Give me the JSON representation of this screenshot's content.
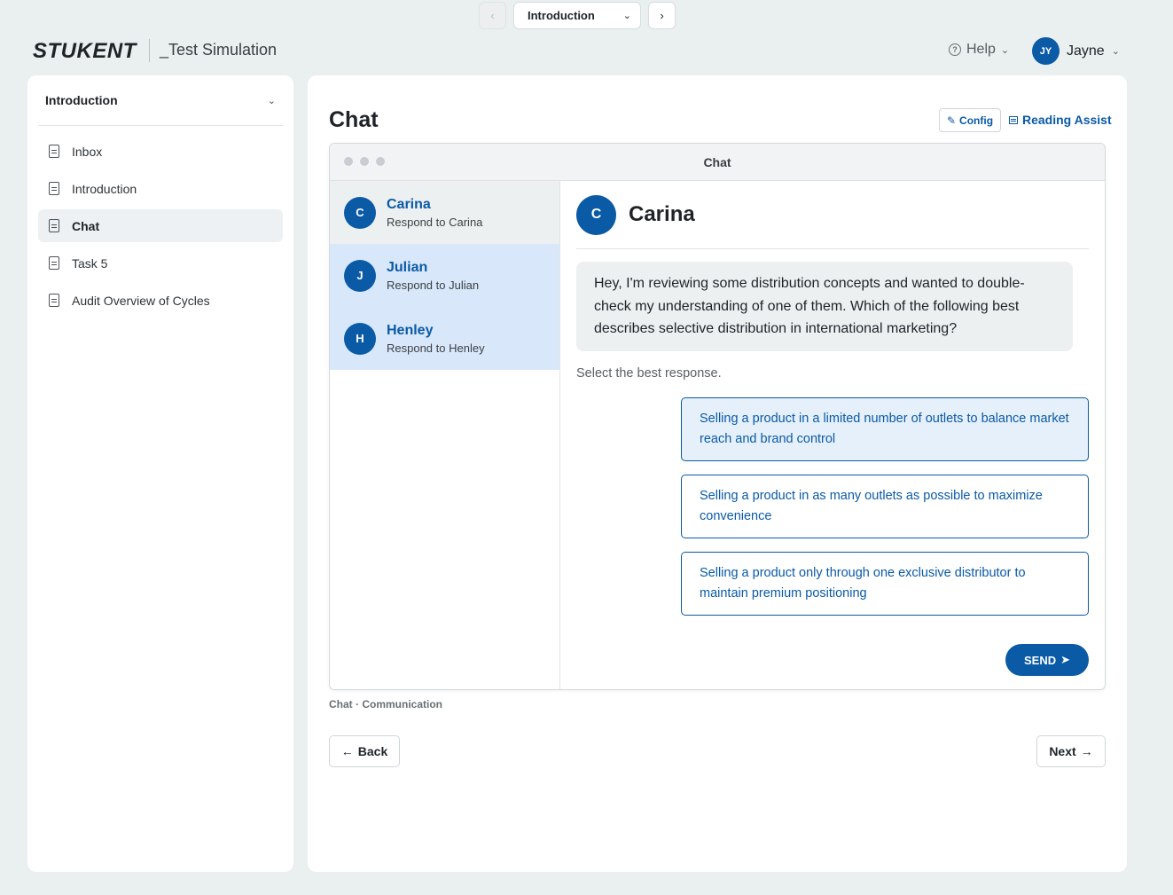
{
  "topnav": {
    "prev_symbol": "‹",
    "next_symbol": "›",
    "selected_module": "Introduction",
    "chevron": "⌄"
  },
  "header": {
    "logo": "STUKENT",
    "simulation_title": "_Test Simulation",
    "help_label": "Help",
    "help_chevron": "⌄",
    "user_initials": "JY",
    "user_name": "Jayne",
    "user_chevron": "⌄"
  },
  "sidebar": {
    "title": "Introduction",
    "chevron": "⌄",
    "items": [
      {
        "label": "Inbox"
      },
      {
        "label": "Introduction"
      },
      {
        "label": "Chat"
      },
      {
        "label": "Task 5"
      },
      {
        "label": "Audit Overview of Cycles"
      }
    ]
  },
  "main": {
    "title": "Chat",
    "config_label": "Config",
    "reading_assist_label": "Reading Assist",
    "window_title": "Chat",
    "contacts": [
      {
        "initial": "C",
        "name": "Carina",
        "subtitle": "Respond to Carina"
      },
      {
        "initial": "J",
        "name": "Julian",
        "subtitle": "Respond to Julian"
      },
      {
        "initial": "H",
        "name": "Henley",
        "subtitle": "Respond to Henley"
      }
    ],
    "conversation": {
      "initial": "C",
      "name": "Carina",
      "message": "Hey, I'm reviewing some distribution concepts and wanted to double-check my understanding of one of them. Which of the following best describes selective distribution in international marketing?",
      "hint": "Select the best response.",
      "options": [
        "Selling a product in a limited number of outlets to balance market reach and brand control",
        "Selling a product in as many outlets as possible to maximize convenience",
        "Selling a product only through one exclusive distributor to maintain premium positioning"
      ],
      "send_label": "SEND",
      "send_arrow": "➤"
    },
    "caption": "Chat · Communication",
    "back_label": "Back",
    "next_label": "Next",
    "back_arrow": "←",
    "next_arrow": "→"
  },
  "colors": {
    "accent": "#0a5aa6",
    "background": "#eaeff0",
    "contact_highlight": "#d8e7fa"
  }
}
